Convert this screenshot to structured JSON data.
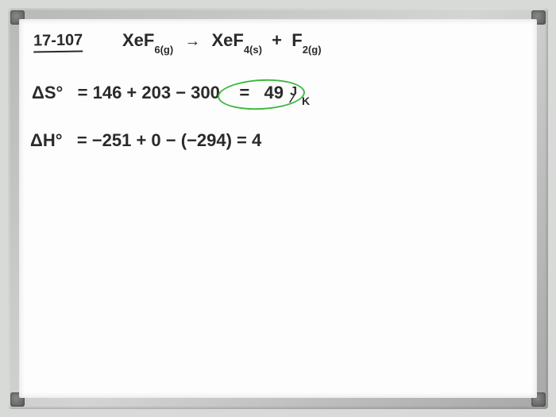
{
  "problem_number": "17-107",
  "equation": {
    "reactant": "XeF",
    "reactant_sub": "6(g)",
    "product1": "XeF",
    "product1_sub": "4(s)",
    "product2": "F",
    "product2_sub": "2(g)"
  },
  "entropy": {
    "label": "ΔS°",
    "expr": "= 146 + 203 − 300",
    "result_eq": "=",
    "result_val": "49",
    "unit_top": "J",
    "unit_bot": "K"
  },
  "enthalpy": {
    "label": "ΔH°",
    "expr": "= −251 + 0 − (−294) = 4"
  }
}
